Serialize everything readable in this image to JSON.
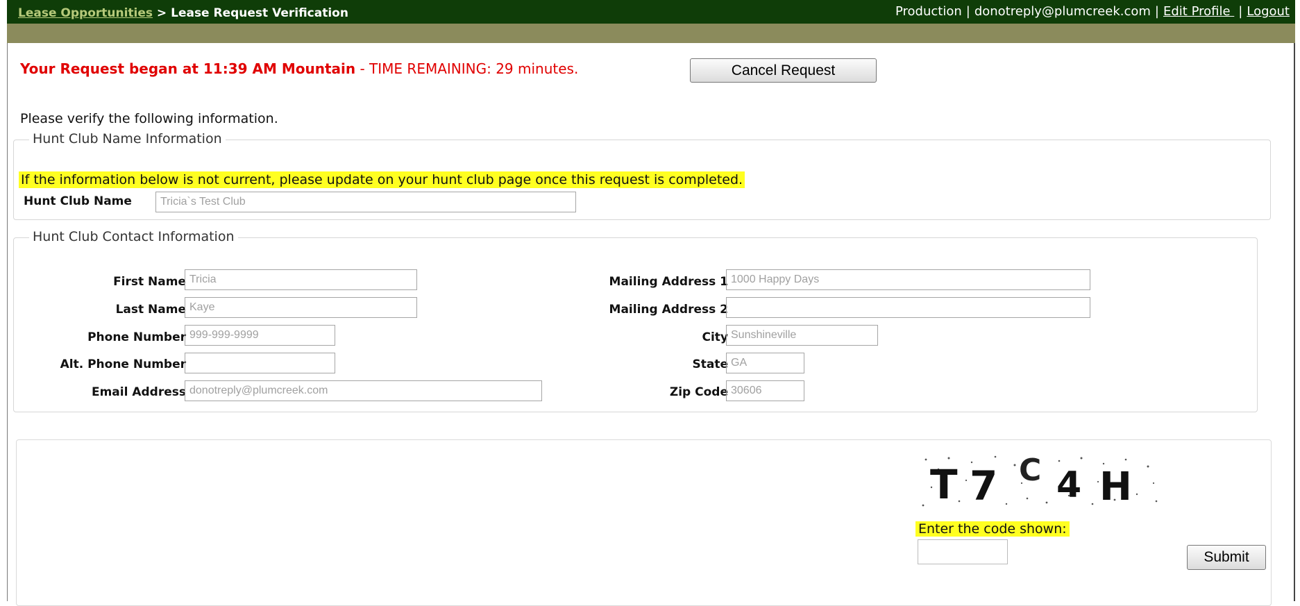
{
  "header": {
    "breadcrumb_link": "Lease Opportunities",
    "breadcrumb_sep": " > ",
    "breadcrumb_current": "Lease Request Verification",
    "environment": "Production",
    "user_email": "donotreply@plumcreek.com",
    "edit_profile": "Edit Profile ",
    "logout": "Logout"
  },
  "timer": {
    "began_text": "Your Request began at 11:39 AM Mountain",
    "remaining_text": " - TIME REMAINING: 29 minutes.",
    "cancel_label": "Cancel Request"
  },
  "intro": "Please verify the following information.",
  "hunt_club": {
    "legend": "Hunt Club Name Information",
    "notice": "If the information below is not current, please update on your hunt club page once this request is completed.",
    "name_label": "Hunt Club Name",
    "name_value": "Tricia`s Test Club"
  },
  "contact": {
    "legend": "Hunt Club Contact Information",
    "first_name_label": "First Name",
    "first_name_value": "Tricia",
    "last_name_label": "Last Name",
    "last_name_value": "Kaye",
    "phone_label": "Phone Number",
    "phone_value": "999-999-9999",
    "alt_phone_label": "Alt. Phone Number",
    "alt_phone_value": "",
    "email_label": "Email Address",
    "email_value": "donotreply@plumcreek.com",
    "addr1_label": "Mailing Address 1",
    "addr1_value": "1000 Happy Days",
    "addr2_label": "Mailing Address 2",
    "addr2_value": "",
    "city_label": "City",
    "city_value": "Sunshineville",
    "state_label": "State",
    "state_value": "GA",
    "zip_label": "Zip Code",
    "zip_value": "30606"
  },
  "captcha": {
    "code": "T7C4H",
    "prompt": "Enter the code shown:",
    "input_value": "",
    "submit_label": "Submit"
  },
  "colors": {
    "topbar": "#0f3d08",
    "stripe": "#8b8b5c",
    "alert_red": "#e00000",
    "highlight": "#ffff21"
  }
}
